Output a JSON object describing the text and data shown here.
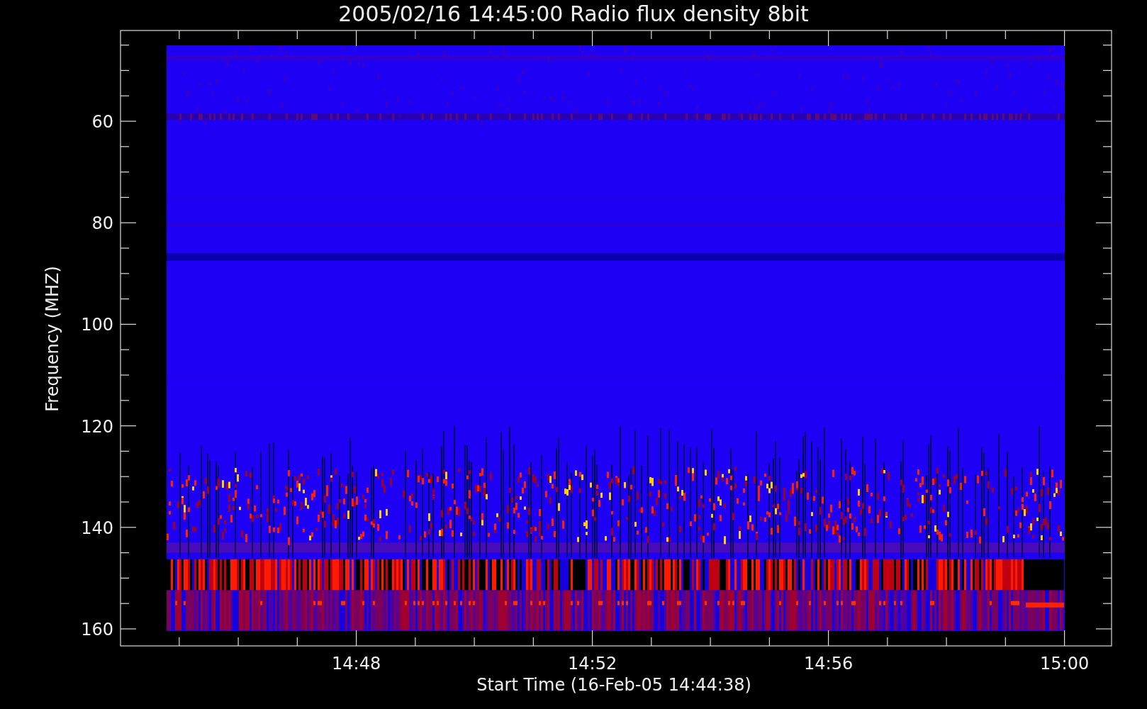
{
  "title": "2005/02/16 14:45:00 Radio flux density 8bit",
  "y_axis": {
    "label": "Frequency (MHZ)",
    "ticks": [
      "60",
      "80",
      "100",
      "120",
      "140",
      "160"
    ]
  },
  "x_axis": {
    "label": "Start Time (16-Feb-05 14:44:38)",
    "ticks": [
      "14:48",
      "14:52",
      "14:56",
      "15:00"
    ]
  }
}
